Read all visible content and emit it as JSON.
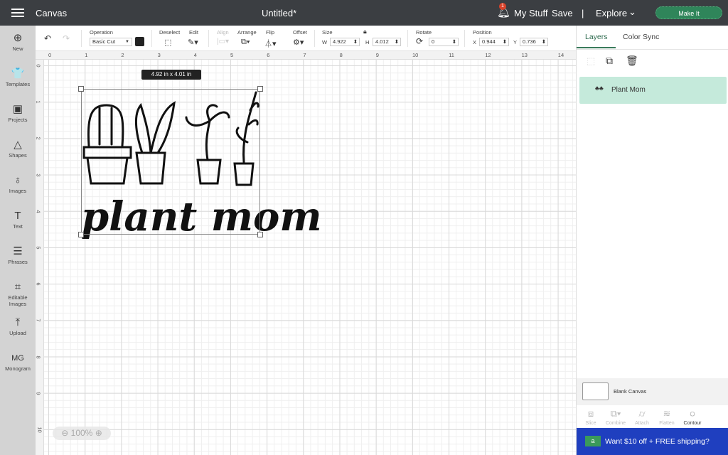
{
  "header": {
    "menu_icon": "hamburger-icon",
    "app": "Canvas",
    "title": "Untitled*",
    "notif_count": "1",
    "my_stuff": "My Stuff",
    "save": "Save",
    "divider": "|",
    "explore": "Explore",
    "make_it": "Make It"
  },
  "sidebar": {
    "items": [
      {
        "label": "New",
        "icon": "⊕"
      },
      {
        "label": "Templates",
        "icon": "👕"
      },
      {
        "label": "Projects",
        "icon": "▣"
      },
      {
        "label": "Shapes",
        "icon": "△"
      },
      {
        "label": "Images",
        "icon": "♁"
      },
      {
        "label": "Text",
        "icon": "T"
      },
      {
        "label": "Phrases",
        "icon": "☰"
      },
      {
        "label": "Editable Images",
        "icon": "⌗"
      },
      {
        "label": "Upload",
        "icon": "⤒"
      },
      {
        "label": "Monogram",
        "icon": "MG"
      }
    ]
  },
  "toolbar": {
    "operation_label": "Operation",
    "operation_value": "Basic Cut",
    "color": "#222222",
    "deselect": "Deselect",
    "edit": "Edit",
    "align": "Align",
    "arrange": "Arrange",
    "flip": "Flip",
    "offset": "Offset",
    "size": "Size",
    "w_label": "W",
    "w": "4.922",
    "h_label": "H",
    "h": "4.012",
    "rotate": "Rotate",
    "rotate_value": "0",
    "position": "Position",
    "x_label": "X",
    "x": "0.944",
    "y_label": "Y",
    "y": "0.736"
  },
  "ruler": {
    "top": [
      "0",
      "1",
      "2",
      "3",
      "4",
      "5",
      "6",
      "7",
      "8",
      "9",
      "10",
      "11",
      "12",
      "13",
      "14"
    ],
    "left": [
      "0",
      "1",
      "2",
      "3",
      "4",
      "5",
      "6",
      "7",
      "8",
      "9",
      "10"
    ]
  },
  "canvas": {
    "dimension_label": "4.92  in x 4.01  in",
    "design_text": "plant mom",
    "zoom": "100%"
  },
  "panel": {
    "tabs": [
      "Layers",
      "Color Sync"
    ],
    "layer_name": "Plant Mom",
    "blank_canvas": "Blank Canvas",
    "tools": [
      "Slice",
      "Combine",
      "Attach",
      "Flatten",
      "Contour"
    ],
    "promo": "Want $10 off + FREE shipping?"
  }
}
